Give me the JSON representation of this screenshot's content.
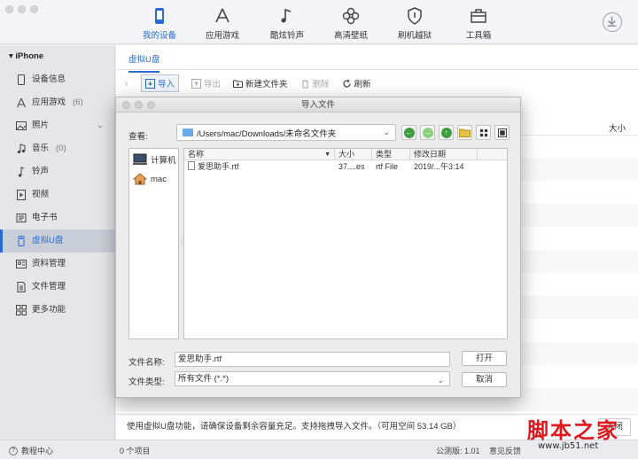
{
  "nav": {
    "items": [
      {
        "label": "我的设备",
        "icon": "phone-icon",
        "active": true
      },
      {
        "label": "应用游戏",
        "icon": "app-store-icon",
        "active": false
      },
      {
        "label": "酷炫铃声",
        "icon": "music-note-icon",
        "active": false
      },
      {
        "label": "高清壁纸",
        "icon": "flower-icon",
        "active": false
      },
      {
        "label": "刷机越狱",
        "icon": "shield-icon",
        "active": false
      },
      {
        "label": "工具箱",
        "icon": "toolbox-icon",
        "active": false
      }
    ],
    "accent": "#2a6bd1"
  },
  "sidebar": {
    "device": "iPhone",
    "items": [
      {
        "label": "设备信息",
        "icon": "device-info-icon",
        "count": ""
      },
      {
        "label": "应用游戏",
        "icon": "app-icon",
        "count": "(6)"
      },
      {
        "label": "照片",
        "icon": "photo-icon",
        "count": ""
      },
      {
        "label": "音乐",
        "icon": "music-icon",
        "count": "(0)"
      },
      {
        "label": "铃声",
        "icon": "ringtone-icon",
        "count": ""
      },
      {
        "label": "视频",
        "icon": "video-icon",
        "count": ""
      },
      {
        "label": "电子书",
        "icon": "ebook-icon",
        "count": ""
      },
      {
        "label": "虚拟U盘",
        "icon": "usb-drive-icon",
        "count": ""
      },
      {
        "label": "资料管理",
        "icon": "data-icon",
        "count": ""
      },
      {
        "label": "文件管理",
        "icon": "file-icon",
        "count": ""
      },
      {
        "label": "更多功能",
        "icon": "grid-icon",
        "count": ""
      }
    ]
  },
  "main": {
    "tab": "虚拟U盘",
    "toolbar": {
      "import": "导入",
      "export": "导出",
      "new_folder": "新建文件夹",
      "delete": "删除",
      "refresh": "刷新"
    },
    "size_col": "大小",
    "footer_text": "使用虚拟U盘功能，请确保设备剩余容量充足。支持拖拽导入文件。（可用空间 53.14 GB）",
    "close": "关闭"
  },
  "dialog": {
    "title": "导入文件",
    "look_in_label": "查看:",
    "look_in_path": "/Users/mac/Downloads/未命名文件夹",
    "places": [
      {
        "label": "计算机",
        "icon": "computer-icon"
      },
      {
        "label": "mac",
        "icon": "home-icon"
      }
    ],
    "columns": [
      "名称",
      "大小",
      "类型",
      "修改日期"
    ],
    "files": [
      {
        "name": "爱思助手.rtf",
        "size": "37....es",
        "type": "rtf File",
        "date": "2019/...午3:14"
      }
    ],
    "file_name_label": "文件名称:",
    "file_name_value": "爱思助手.rtf",
    "file_type_label": "文件类型:",
    "file_type_value": "所有文件 (*.*)",
    "open": "打开",
    "cancel": "取消"
  },
  "status": {
    "help": "教程中心",
    "count": "0 个项目",
    "version": "公测版: 1.01",
    "feedback": "意见反馈"
  },
  "watermark": {
    "text": "脚本之家",
    "url": "www.jb51.net"
  }
}
